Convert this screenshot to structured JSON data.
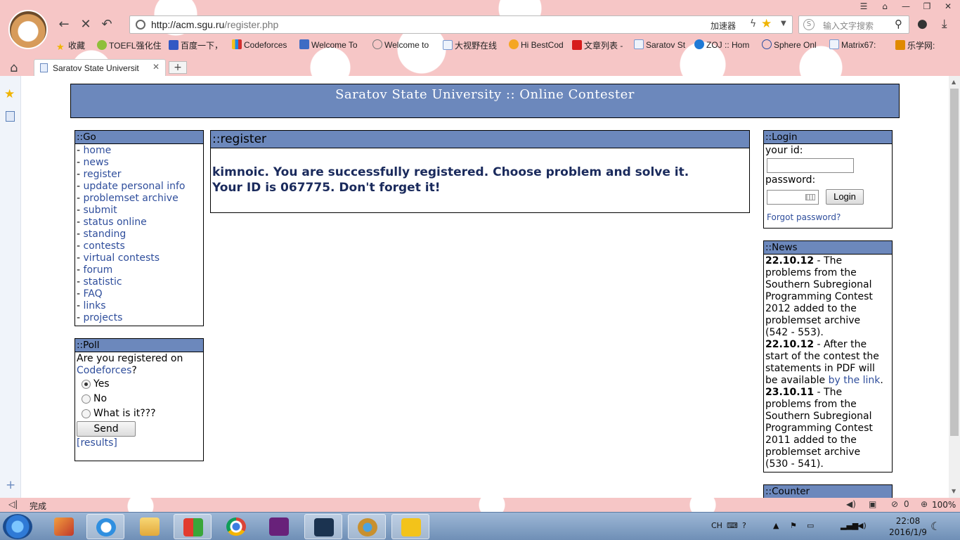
{
  "browser": {
    "url_host": "http://acm.sgu.ru",
    "url_path": "/register.php",
    "accelerator_label": "加速器",
    "search_placeholder": "输入文字搜索",
    "bookmarks": [
      "收藏",
      "TOEFL强化住",
      "百度一下，",
      "Codeforces",
      "Welcome To",
      "Welcome to",
      "大视野在线",
      "Hi BestCod",
      "文章列表 -",
      "Saratov St",
      "ZOJ :: Hom",
      "Sphere Onl",
      "Matrix67:",
      "乐学网:"
    ],
    "tab_title": "Saratov State Universit",
    "status_text": "完成",
    "status_count": "0",
    "zoom": "100%",
    "colors": {
      "banner": "#6c88bc",
      "link": "#2f4e9c",
      "message": "#1a2a5c"
    }
  },
  "site": {
    "title": "Saratov State University :: Online Contester"
  },
  "go": {
    "heading": "::Go",
    "items": [
      "home",
      "news",
      "register",
      "update personal info",
      "problemset archive",
      "submit",
      "status online",
      "standing",
      "contests",
      "virtual contests",
      "forum",
      "statistic",
      "FAQ",
      "links",
      "projects"
    ]
  },
  "poll": {
    "heading": "::Poll",
    "question_prefix": "Are you registered on",
    "question_link": "Codeforces",
    "question_suffix": "?",
    "options": [
      "Yes",
      "No",
      "What is it???"
    ],
    "selected": "Yes",
    "send_label": "Send",
    "results_label": "[results]"
  },
  "register": {
    "heading": "::register",
    "message_line1": "kimnoic. You are successfully registered. Choose problem and solve it.",
    "message_line2": "Your ID is 067775. Don't forget it!"
  },
  "login": {
    "heading": "::Login",
    "id_label": "your id:",
    "password_label": "password:",
    "login_label": "Login",
    "forgot_label": "Forgot password?"
  },
  "news": {
    "heading": "::News",
    "items": [
      {
        "date": "22.10.12",
        "lines": [
          "- The",
          "problems from the",
          "Southern Subregional",
          "Programming Contest",
          "2012 added to the",
          "problemset archive",
          "(542 - 553)."
        ]
      },
      {
        "date": "22.10.12",
        "lines_before_link": [
          "- After the",
          "start of the contest the",
          "statements in PDF will",
          "be available "
        ],
        "link": "by the link",
        "after_link": "."
      },
      {
        "date": "23.10.11",
        "lines": [
          "- The",
          "problems from the",
          "Southern Subregional",
          "Programming Contest",
          "2011 added to the",
          "problemset archive",
          "(530 - 541)."
        ]
      }
    ]
  },
  "counter": {
    "heading": "::Counter"
  },
  "taskbar": {
    "ime": "CH",
    "time": "22:08",
    "date": "2016/1/9"
  }
}
